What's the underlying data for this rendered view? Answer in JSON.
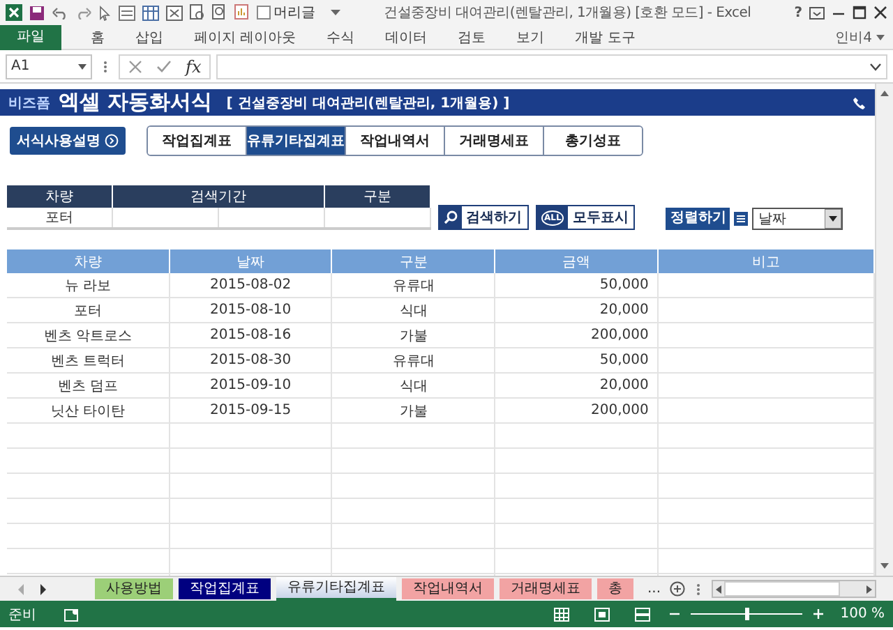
{
  "window": {
    "title": "건설중장비 대여관리(렌탈관리, 1개월용)  [호환 모드] - Excel",
    "header_checkbox": {
      "label": "머리글",
      "checked": false
    },
    "help": "?"
  },
  "ribbon": {
    "tabs": [
      {
        "label": "파일",
        "kind": "file"
      },
      {
        "label": "홈",
        "kind": "tab"
      },
      {
        "label": "삽입",
        "kind": "tab"
      },
      {
        "label": "페이지 레이아웃",
        "kind": "tab"
      },
      {
        "label": "수식",
        "kind": "tab"
      },
      {
        "label": "데이터",
        "kind": "tab"
      },
      {
        "label": "검토",
        "kind": "tab"
      },
      {
        "label": "보기",
        "kind": "tab"
      },
      {
        "label": "개발 도구",
        "kind": "tab"
      }
    ],
    "user": "인비4"
  },
  "formula_bar": {
    "name_box": "A1",
    "fx": "fx"
  },
  "banner": {
    "logo": "비즈폼",
    "title": "엑셀 자동화서식",
    "subtitle": "[ 건설중장비 대여관리(렌탈관리, 1개월용) ]"
  },
  "guide_button": "서식사용설명",
  "nav_tabs": [
    {
      "label": "작업집계표",
      "selected": false
    },
    {
      "label": "유류기타집계표",
      "selected": true
    },
    {
      "label": "작업내역서",
      "selected": false
    },
    {
      "label": "거래명세표",
      "selected": false
    },
    {
      "label": "총기성표",
      "selected": false
    }
  ],
  "search": {
    "columns": [
      "차량",
      "검색기간",
      "구분"
    ],
    "vehicle": "포터"
  },
  "actions": {
    "search_button": "검색하기",
    "all_badge": "ALL",
    "show_all_button": "모두표시",
    "sort_label": "정렬하기",
    "sort_value": "날짜"
  },
  "table": {
    "columns": [
      "차량",
      "날짜",
      "구분",
      "금액",
      "비고"
    ],
    "rows": [
      [
        "뉴 라보",
        "2015-08-02",
        "유류대",
        "50,000"
      ],
      [
        "포터",
        "2015-08-10",
        "식대",
        "20,000"
      ],
      [
        "벤츠 악트로스",
        "2015-08-16",
        "가불",
        "200,000"
      ],
      [
        "벤츠 트럭터",
        "2015-08-30",
        "유류대",
        "50,000"
      ],
      [
        "벤츠 덤프",
        "2015-09-10",
        "식대",
        "20,000"
      ],
      [
        "닛산 타이탄",
        "2015-09-15",
        "가불",
        "200,000"
      ]
    ]
  },
  "sheet_tabs": [
    {
      "label": "사용방법",
      "color": "#9ccf78",
      "selected": false
    },
    {
      "label": "작업집계표",
      "color": "#000080",
      "selected": false
    },
    {
      "label": "유류기타집계표",
      "color": "#c8d4e8",
      "selected": true
    },
    {
      "label": "작업내역서",
      "color": "#f2a3a3",
      "selected": false
    },
    {
      "label": "거래명세표",
      "color": "#f2a3a3",
      "selected": false
    },
    {
      "label": "총",
      "color": "#f2a3a3",
      "selected": false
    }
  ],
  "sheet_more": "...",
  "status_bar": {
    "text": "준비",
    "zoom_level": {
      "level": 0.5
    },
    "zoom": "100 %"
  }
}
